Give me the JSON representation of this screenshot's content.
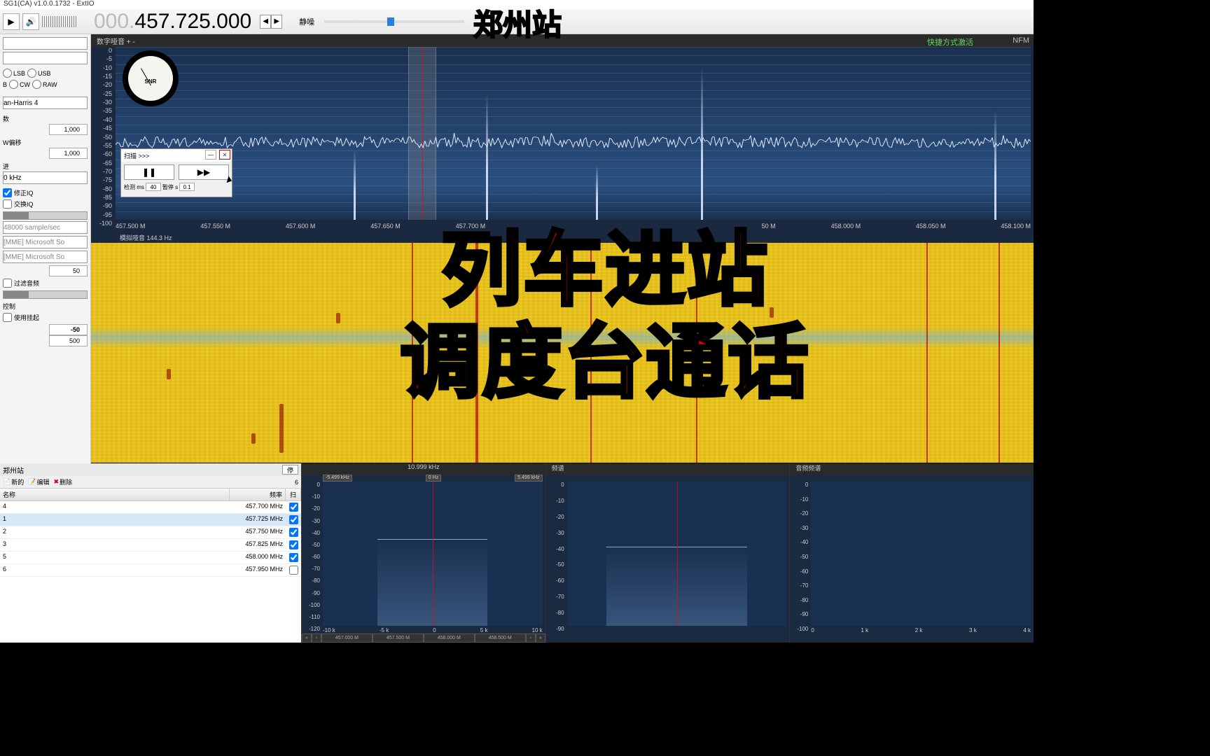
{
  "titlebar": "SG1(CA)  v1.0.0.1732 - ExtIO",
  "frequency": {
    "prefix": "000.",
    "main": "457.725.000"
  },
  "squelch_label": "静噪",
  "spectrum": {
    "header": "数字哑音 + -",
    "activation": "快捷方式激活",
    "mode": "NFM",
    "footer": "模拟哑音  144.3 Hz",
    "db_scale": [
      "0",
      "-5",
      "-10",
      "-15",
      "-20",
      "-25",
      "-30",
      "-35",
      "-40",
      "-45",
      "-50",
      "-55",
      "-60",
      "-65",
      "-70",
      "-75",
      "-80",
      "-85",
      "-90",
      "-95",
      "-100"
    ],
    "freq_scale": [
      "457.500 M",
      "457.550 M",
      "457.600 M",
      "457.650 M",
      "457.700 M",
      "",
      "",
      "",
      "",
      "50 M",
      "458.000 M",
      "458.050 M",
      "458.100 M"
    ],
    "snr_label": "SNR"
  },
  "scan": {
    "title": "扫描 >>>",
    "detect_label": "检测 ms",
    "detect_val": "40",
    "pause_label": "暂停 s",
    "pause_val": "0.1"
  },
  "sidebar": {
    "modes": [
      "",
      "LSB",
      "USB",
      "",
      "CW",
      "RAW"
    ],
    "window": "an-Harris 4",
    "label_numbers": "数",
    "num1": "1,000",
    "label_offset": "W偏移",
    "num2": "1,000",
    "label_step": "进",
    "step": "0 kHz",
    "check_fixiq": "修正IQ",
    "check_swapiq": "交换IQ",
    "samplerate": "48000 sample/sec",
    "audio_in": "[MME] Microsoft So",
    "audio_out": "[MME] Microsoft So",
    "vol": "50",
    "check_audio": "过滤音频",
    "ctrl_label": "控制",
    "check_hang": "使用挂起",
    "num3": "-50",
    "num4": "500"
  },
  "freqlist": {
    "title": "郑州站",
    "stop_btn": "停",
    "new_btn": "新的",
    "edit_btn": "编辑",
    "del_btn": "删除",
    "count": "6",
    "col_name": "名称",
    "col_freq": "频率",
    "col_scan": "扫",
    "rows": [
      {
        "name": "4",
        "freq": "457.700 MHz",
        "chk": true,
        "sel": false
      },
      {
        "name": "1",
        "freq": "457.725 MHz",
        "chk": true,
        "sel": true
      },
      {
        "name": "2",
        "freq": "457.750 MHz",
        "chk": true,
        "sel": false
      },
      {
        "name": "3",
        "freq": "457.825 MHz",
        "chk": true,
        "sel": false
      },
      {
        "name": "5",
        "freq": "458.000 MHz",
        "chk": true,
        "sel": false
      },
      {
        "name": "6",
        "freq": "457.950 MHz",
        "chk": false,
        "sel": false
      }
    ]
  },
  "audio_panels": {
    "bw_label": "10.999 kHz",
    "markers": [
      "-5.499 kHz",
      "0 Hz",
      "5.499 kHz"
    ],
    "panel1_db": [
      "0",
      "-10",
      "-20",
      "-30",
      "-40",
      "-50",
      "-60",
      "-70",
      "-80",
      "-90",
      "-100",
      "-110",
      "-120"
    ],
    "panel1_x": [
      "-10 k",
      "-5 k",
      "0",
      "5 k",
      "10 k"
    ],
    "panel1_nav": [
      "457.000 M",
      "457.500 M",
      "458.000 M",
      "458.500 M"
    ],
    "panel2_title": "频谱",
    "panel2_db": [
      "0",
      "-10",
      "-20",
      "-30",
      "-40",
      "-50",
      "-60",
      "-70",
      "-80",
      "-90"
    ],
    "panel3_title": "音频频谱",
    "panel3_db": [
      "0",
      "-10",
      "-20",
      "-30",
      "-40",
      "-50",
      "-60",
      "-70",
      "-80",
      "-90",
      "-100"
    ],
    "panel3_x": [
      "0",
      "1 k",
      "2 k",
      "3 k",
      "4 k"
    ]
  },
  "overlay": {
    "station": "郑州站",
    "line1": "列车进站",
    "line2": "调度台通话"
  }
}
